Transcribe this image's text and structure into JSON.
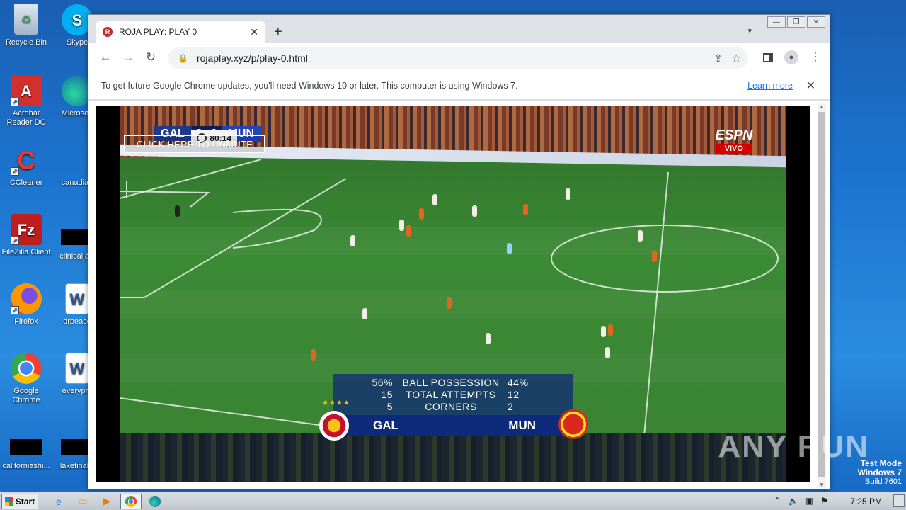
{
  "desktop": {
    "icons": [
      {
        "label": "Recycle Bin",
        "icon": "recycle-bin-icon"
      },
      {
        "label": "Acrobat Reader DC",
        "icon": "acrobat-icon"
      },
      {
        "label": "CCleaner",
        "icon": "ccleaner-icon"
      },
      {
        "label": "FileZilla Client",
        "icon": "filezilla-icon"
      },
      {
        "label": "Firefox",
        "icon": "firefox-icon"
      },
      {
        "label": "Google Chrome",
        "icon": "chrome-icon"
      },
      {
        "label": "californiashi...",
        "icon": "file-icon"
      },
      {
        "label": "Skype",
        "icon": "skype-icon"
      },
      {
        "label": "Microsoft",
        "icon": "edge-icon"
      },
      {
        "label": "canadian",
        "icon": "file-icon"
      },
      {
        "label": "clinicaljacl",
        "icon": "file-icon"
      },
      {
        "label": "drpeace",
        "icon": "word-icon"
      },
      {
        "label": "everypre",
        "icon": "word-icon"
      },
      {
        "label": "lakefinally",
        "icon": "file-icon"
      }
    ]
  },
  "browser": {
    "tab": {
      "title": "ROJA PLAY: PLAY 0",
      "favicon": "R"
    },
    "url": "rojaplay.xyz/p/play-0.html",
    "infobar": {
      "message": "To get future Google Chrome updates, you'll need Windows 10 or later. This computer is using Windows 7.",
      "link": "Learn more"
    }
  },
  "video": {
    "scorebug": {
      "clock": "80:14",
      "home": "GAL",
      "home_score": "3",
      "away_score": "3",
      "away": "MUN"
    },
    "unmute_label": "CLICK HERE TO UNMUTE",
    "broadcaster": {
      "brand": "ESPN",
      "tag": "VIVO"
    },
    "stats": {
      "rows": [
        {
          "home": "56%",
          "label": "BALL POSSESSION",
          "away": "44%"
        },
        {
          "home": "15",
          "label": "TOTAL ATTEMPTS",
          "away": "12"
        },
        {
          "home": "5",
          "label": "CORNERS",
          "away": "2"
        }
      ],
      "home_team": "GAL",
      "away_team": "MUN"
    }
  },
  "watermark": "ANY RUN",
  "testmode": {
    "line1": "Test Mode",
    "line2": "Windows 7",
    "line3": "Build 7601"
  },
  "taskbar": {
    "start_label": "Start",
    "time": "7:25 PM"
  }
}
